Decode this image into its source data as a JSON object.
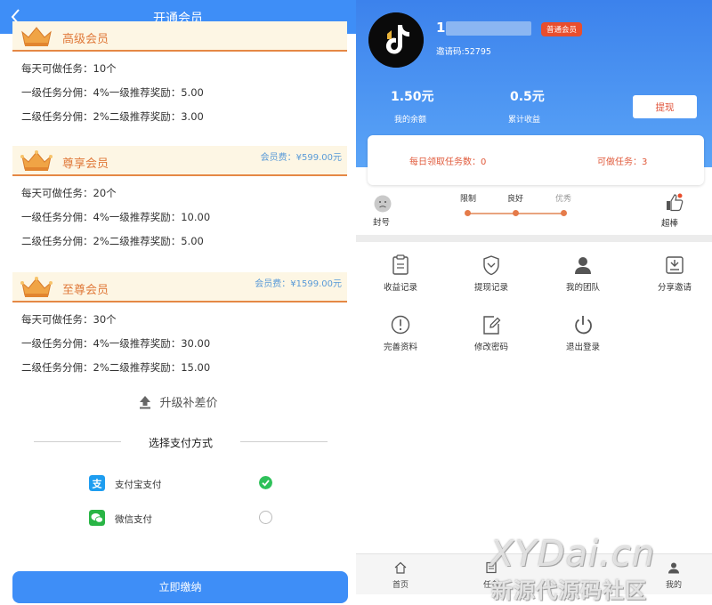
{
  "left": {
    "title": "开通会员",
    "tiers": [
      {
        "name": "高级会员",
        "fee": "",
        "rows": [
          "每天可做任务：10个",
          "一级任务分佣：4%一级推荐奖励：5.00",
          "二级任务分佣：2%二级推荐奖励：3.00"
        ]
      },
      {
        "name": "尊享会员",
        "fee": "会员费：¥599.00元",
        "rows": [
          "每天可做任务：20个",
          "一级任务分佣：4%一级推荐奖励：10.00",
          "二级任务分佣：2%二级推荐奖励：5.00"
        ]
      },
      {
        "name": "至尊会员",
        "fee": "会员费：¥1599.00元",
        "rows": [
          "每天可做任务：30个",
          "一级任务分佣：4%一级推荐奖励：30.00",
          "二级任务分佣：2%二级推荐奖励：15.00"
        ]
      }
    ],
    "upgrade_label": "升级补差价",
    "pay_title": "选择支付方式",
    "pay_methods": [
      {
        "name": "支付宝支付",
        "selected": true
      },
      {
        "name": "微信支付",
        "selected": false
      }
    ],
    "pay_button": "立即缴纳"
  },
  "right": {
    "username": "1",
    "badge": "普通会员",
    "invite_code": "邀请码:52795",
    "balance_value": "1.50元",
    "balance_label": "我的余额",
    "earnings_value": "0.5元",
    "earnings_label": "累计收益",
    "withdraw_button": "提现",
    "daily_tasks": "每日领取任务数：0",
    "available_tasks": "可做任务：3",
    "level": {
      "left_label": "封号",
      "right_label": "超棒",
      "steps": [
        "限制",
        "良好",
        "优秀"
      ]
    },
    "menu": [
      {
        "label": "收益记录",
        "icon": "clipboard-icon"
      },
      {
        "label": "提现记录",
        "icon": "shield-icon"
      },
      {
        "label": "我的团队",
        "icon": "user-icon"
      },
      {
        "label": "分享邀请",
        "icon": "share-icon"
      },
      {
        "label": "完善资料",
        "icon": "info-icon"
      },
      {
        "label": "修改密码",
        "icon": "edit-icon"
      },
      {
        "label": "退出登录",
        "icon": "power-icon"
      }
    ],
    "tabs": [
      "首页",
      "任务",
      "我的"
    ]
  },
  "watermark": {
    "line1": "XYDai.cn",
    "line2": "新源代源码社区"
  },
  "colors": {
    "primary_blue": "#3e8ef7",
    "accent_orange": "#e58845",
    "badge_red": "#e94e2d",
    "check_green": "#2fc15a"
  }
}
